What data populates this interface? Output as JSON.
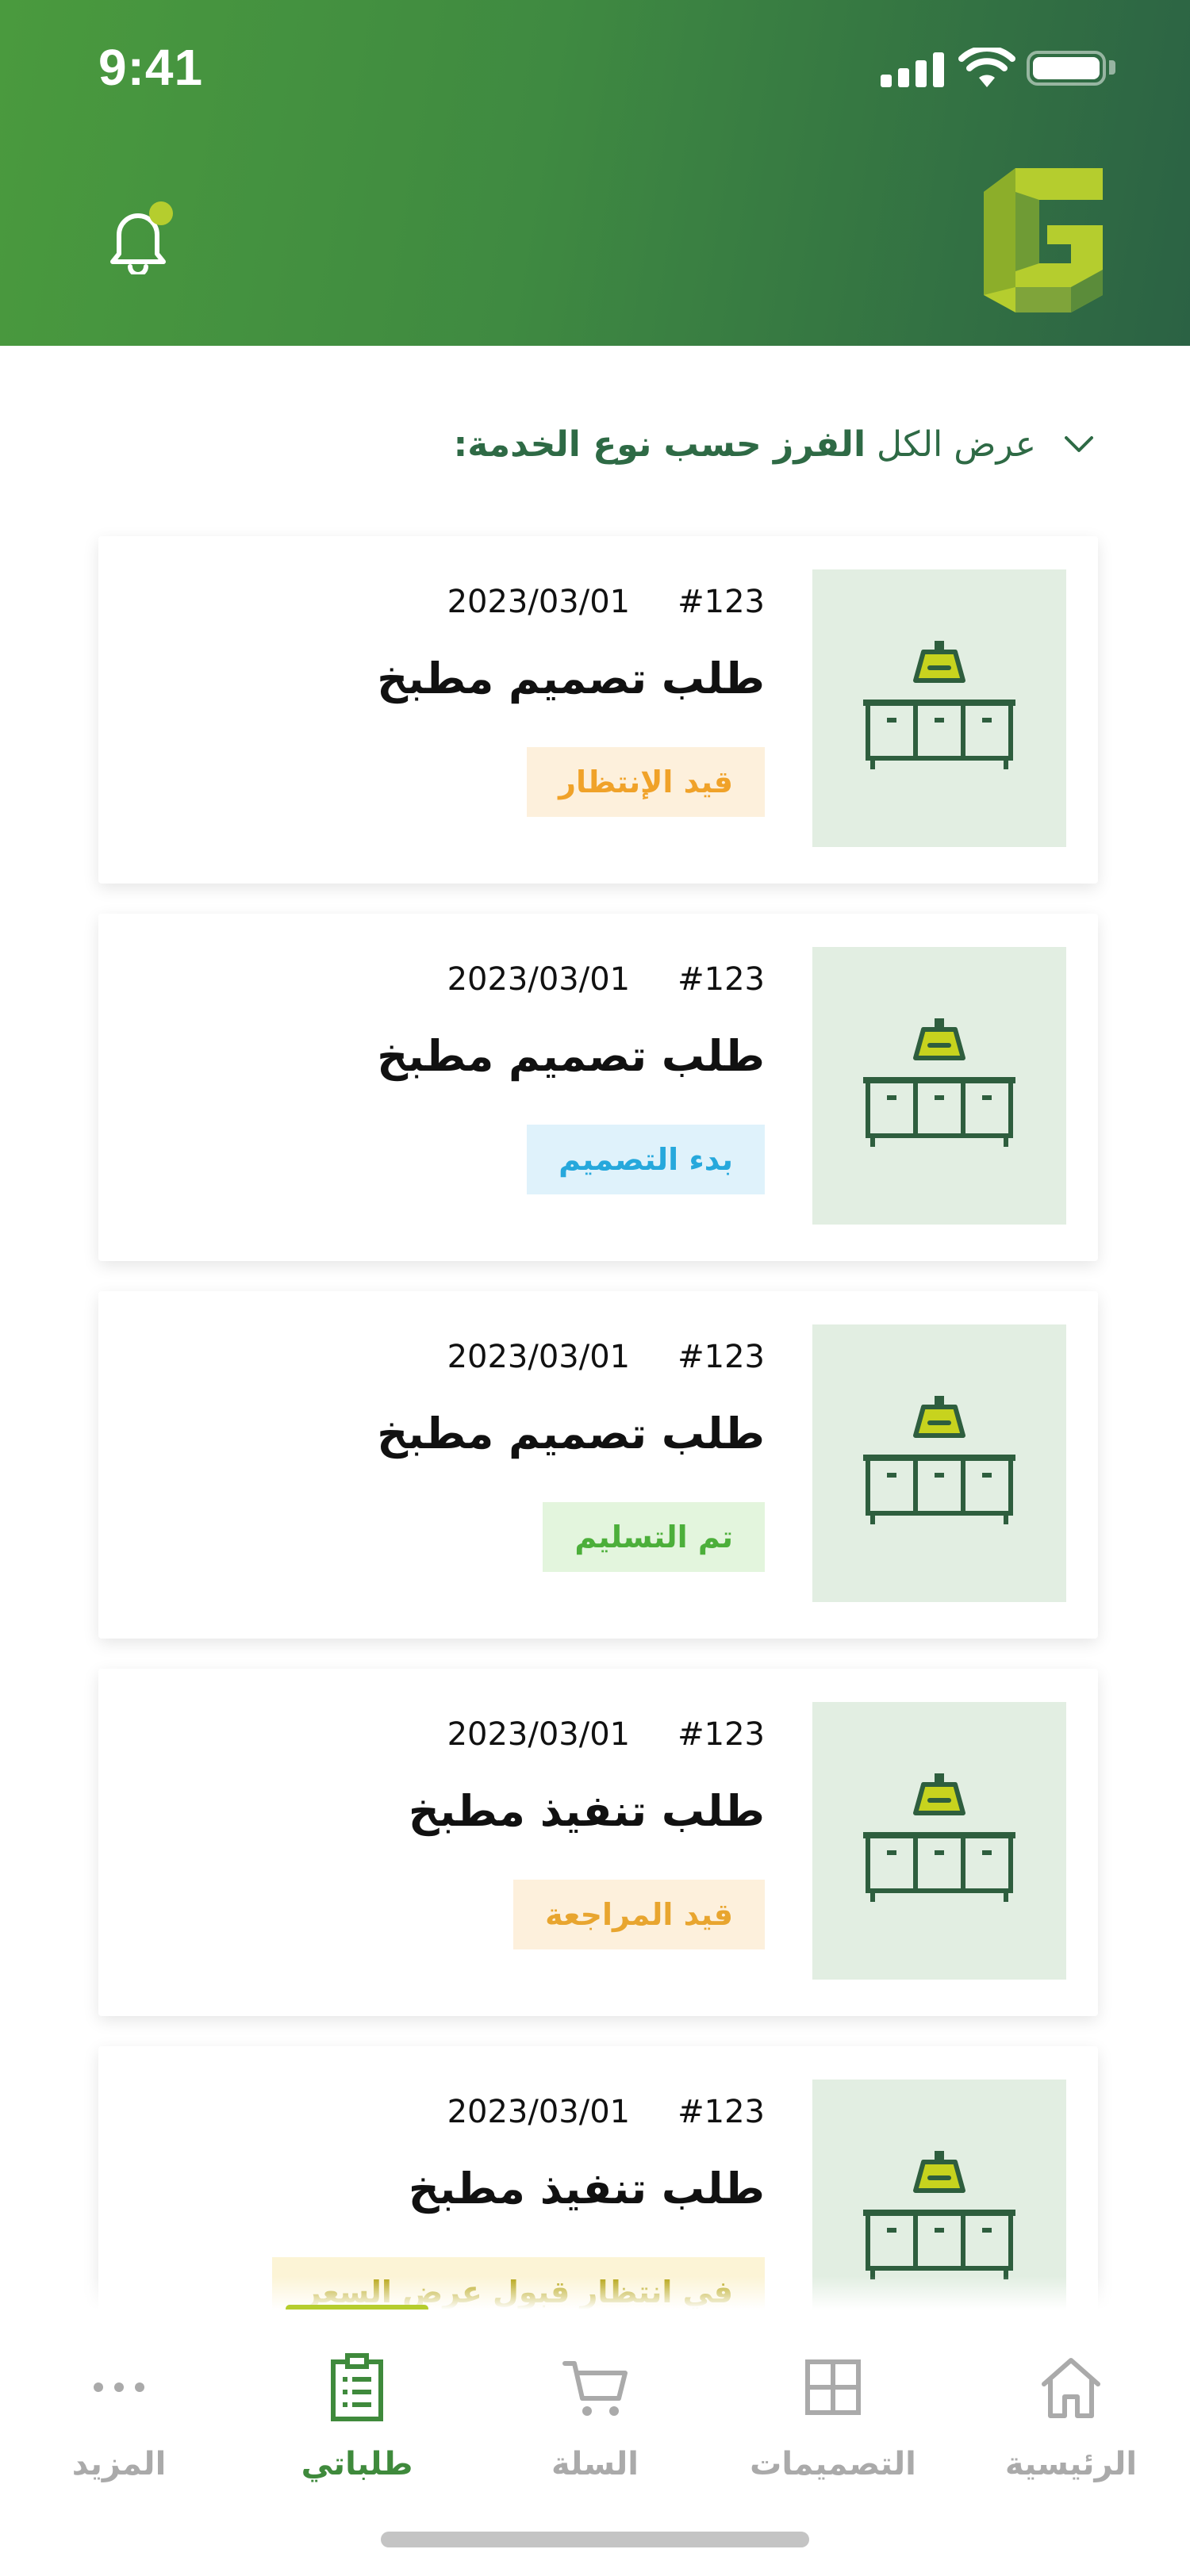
{
  "status_bar": {
    "time": "9:41"
  },
  "header": {
    "logo_icon": "brand-logo",
    "notification_icon": "bell-icon"
  },
  "sort": {
    "label": "الفرز حسب نوع الخدمة:",
    "value": "عرض الكل"
  },
  "orders": [
    {
      "number": "#123",
      "date": "2023/03/01",
      "title": "طلب تصميم مطبخ",
      "status": "قيد الإنتظار",
      "status_color": "#f0a229",
      "status_bg": "#fdf0dc"
    },
    {
      "number": "#123",
      "date": "2023/03/01",
      "title": "طلب تصميم مطبخ",
      "status": "بدء التصميم",
      "status_color": "#26a8dc",
      "status_bg": "#dff2fb"
    },
    {
      "number": "#123",
      "date": "2023/03/01",
      "title": "طلب تصميم مطبخ",
      "status": "تم التسليم",
      "status_color": "#4caf3a",
      "status_bg": "#e3f5dd"
    },
    {
      "number": "#123",
      "date": "2023/03/01",
      "title": "طلب تنفيذ مطبخ",
      "status": "قيد المراجعة",
      "status_color": "#e8a52f",
      "status_bg": "#fdf0dc"
    },
    {
      "number": "#123",
      "date": "2023/03/01",
      "title": "طلب تنفيذ مطبخ",
      "status": "في انتظار قبول عرض السعر",
      "status_color": "#b5a30f",
      "status_bg": "#fcf4d6"
    }
  ],
  "nav": {
    "items": [
      {
        "label": "الرئيسية",
        "icon": "home-icon"
      },
      {
        "label": "التصميمات",
        "icon": "grid-icon"
      },
      {
        "label": "السلة",
        "icon": "cart-icon"
      },
      {
        "label": "طلباتي",
        "icon": "clipboard-icon"
      },
      {
        "label": "المزيد",
        "icon": "more-icon"
      }
    ],
    "active": "طلباتي"
  },
  "colors": {
    "brand_green": "#3f8a41",
    "accent_lime": "#b5cd2e",
    "dark_green": "#2e5e3e"
  }
}
